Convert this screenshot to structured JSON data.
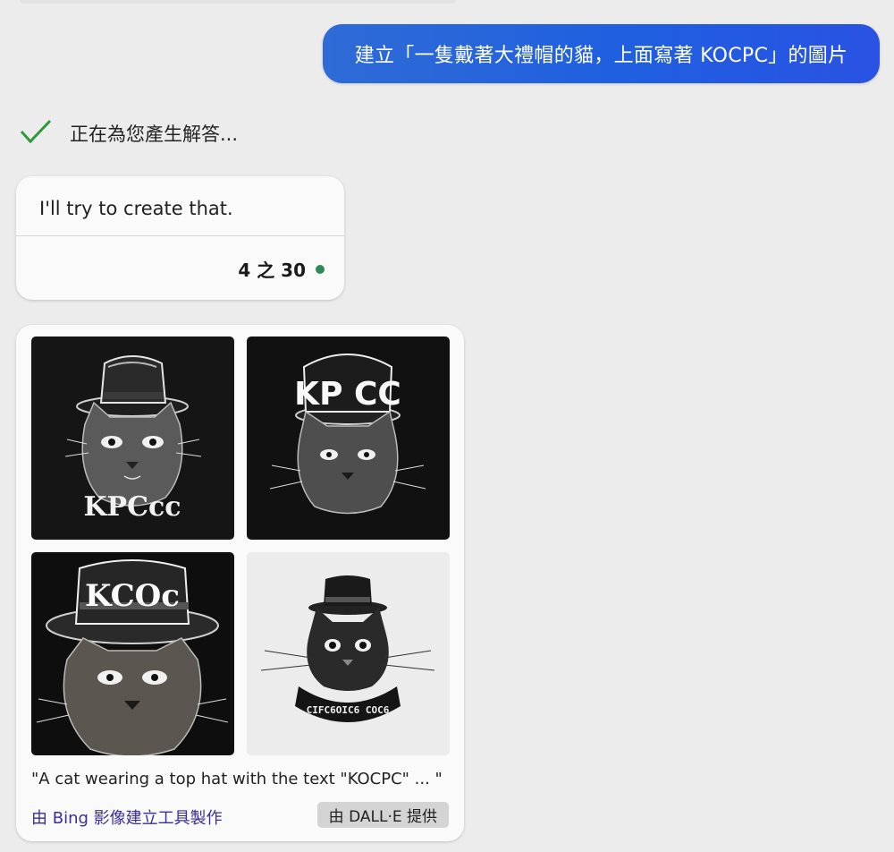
{
  "user_message": "建立「一隻戴著大禮帽的貓，上面寫著 KOCPC」的圖片",
  "status": {
    "icon": "checkmark-icon",
    "text": "正在為您產生解答..."
  },
  "reply": {
    "text": "I'll try to create that.",
    "turn_count": "4 之 30",
    "turn_indicator_color": "#2e8b57"
  },
  "image_results": {
    "images": [
      {
        "lettering": "KPCcc",
        "style": "dark"
      },
      {
        "lettering": "KP CC",
        "style": "dark"
      },
      {
        "lettering": "KCOc",
        "style": "dark"
      },
      {
        "lettering": "CIFC6OIC6 COC6",
        "style": "light"
      }
    ],
    "caption": "\"A cat wearing a top hat with the text \"KOCPC\" ... \"",
    "creator_link": "由 Bing 影像建立工具製作",
    "provider_badge": "由 DALL·E 提供"
  },
  "colors": {
    "user_bubble": "#1f5fe0",
    "check": "#2e9a3a",
    "link": "#3a2e9c",
    "page_bg": "#ececec"
  }
}
